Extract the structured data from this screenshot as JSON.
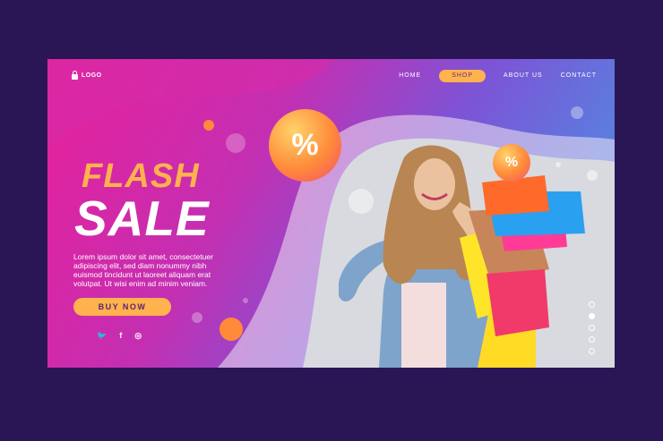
{
  "nav": {
    "logo": "LOGO",
    "items": [
      {
        "label": "HOME"
      },
      {
        "label": "SHOP"
      },
      {
        "label": "ABOUT US"
      },
      {
        "label": "CONTACT"
      }
    ]
  },
  "hero": {
    "title1": "FLASH",
    "title2": "SALE",
    "description": "Lorem ipsum dolor sit amet, consectetuer adipiscing elit, sed diam nonummy nibh euismod tincidunt ut laoreet aliquam erat volutpat. Ut wisi enim ad minim veniam.",
    "cta": "BUY NOW"
  },
  "badges": [
    "%",
    "%"
  ],
  "social": [
    "twitter-icon",
    "facebook-icon",
    "instagram-icon"
  ],
  "colors": {
    "accent": "#ffb24d",
    "pink": "#e8209a",
    "blue": "#3fa0e6",
    "page_bg": "#2b1655"
  }
}
